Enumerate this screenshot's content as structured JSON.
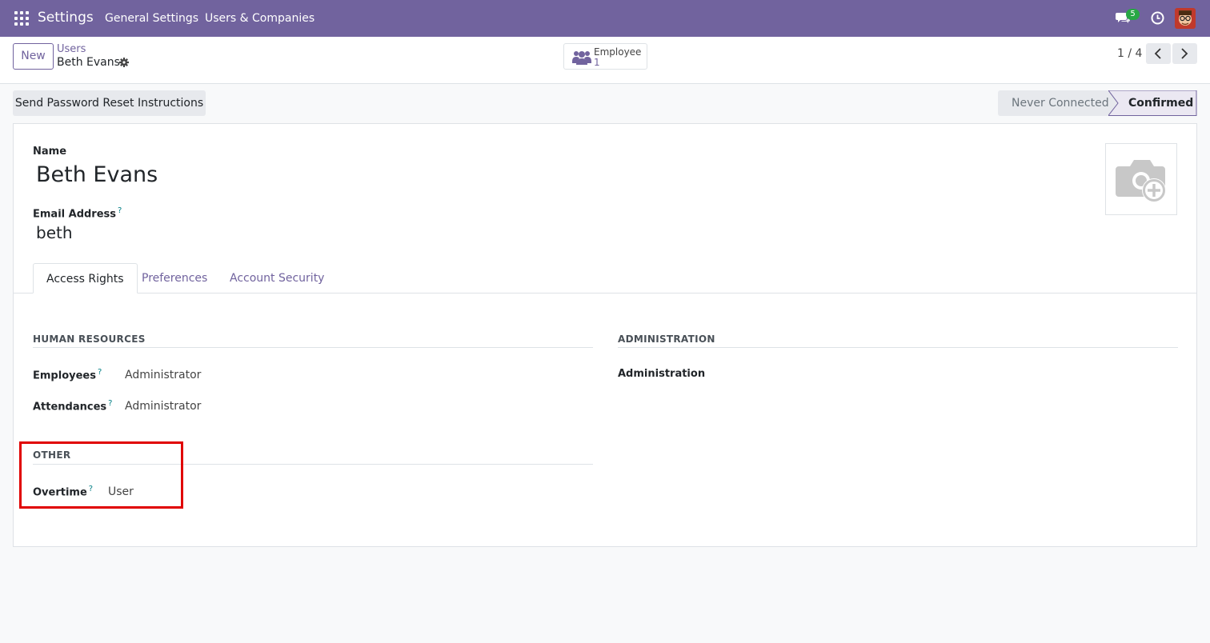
{
  "navbar": {
    "app_name": "Settings",
    "menu": [
      "General Settings",
      "Users & Companies"
    ],
    "chat_count": "5",
    "bg_color": "#71639e"
  },
  "control_panel": {
    "new_label": "New",
    "breadcrumb_parent": "Users",
    "breadcrumb_current": "Beth Evans",
    "smart_button": {
      "label": "Employee",
      "count": "1"
    },
    "pager": "1 / 4"
  },
  "actions": {
    "reset_label": "Send Password Reset Instructions",
    "status": [
      "Never Connected",
      "Confirmed"
    ],
    "status_active": "Confirmed"
  },
  "form": {
    "name_label": "Name",
    "name_value": "Beth Evans",
    "email_label": "Email Address",
    "email_value": "beth",
    "help_mark": "?",
    "tabs": [
      "Access Rights",
      "Preferences",
      "Account Security"
    ],
    "active_tab": "Access Rights"
  },
  "access_rights": {
    "human_resources": {
      "title": "HUMAN RESOURCES",
      "fields": [
        {
          "label": "Employees",
          "value": "Administrator"
        },
        {
          "label": "Attendances",
          "value": "Administrator"
        }
      ]
    },
    "administration": {
      "title": "ADMINISTRATION",
      "fields": [
        {
          "label": "Administration",
          "value": ""
        }
      ]
    },
    "other": {
      "title": "OTHER",
      "fields": [
        {
          "label": "Overtime",
          "value": "User"
        }
      ]
    }
  },
  "icons": [
    "apps-icon",
    "chat-icon",
    "clock-icon",
    "gear-icon",
    "users-icon",
    "chevron-left-icon",
    "chevron-right-icon",
    "camera-plus-icon"
  ],
  "colors": {
    "brand": "#71639e",
    "link": "#71639e",
    "help": "#017e84",
    "highlight": "#e00000",
    "badge": "#28a745"
  }
}
